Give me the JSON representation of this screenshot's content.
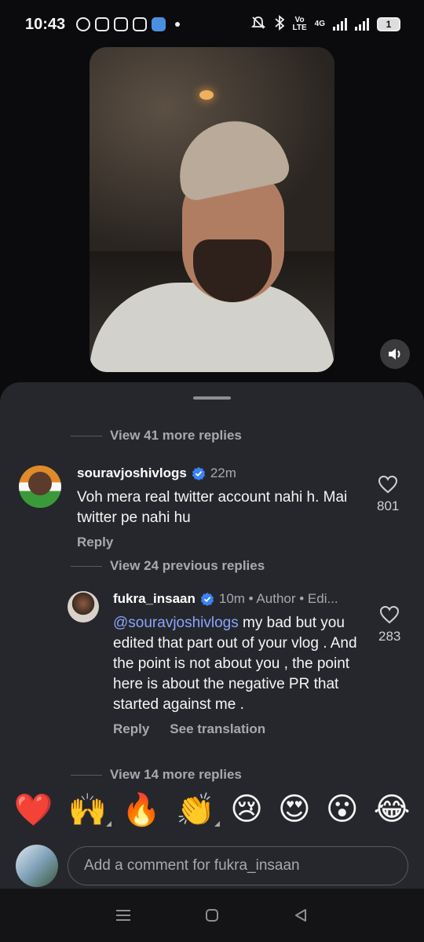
{
  "status_bar": {
    "time": "10:43",
    "net_top": "Vo",
    "net_bottom": "LTE",
    "net_type": "4G",
    "battery": "1"
  },
  "video": {
    "sound_icon": "speaker-icon"
  },
  "thread": {
    "view_more_1": "View 41 more replies",
    "comment_1": {
      "username": "souravjoshivlogs",
      "time": "22m",
      "text": "Voh mera real twitter account nahi h. Mai twitter pe nahi hu",
      "reply_label": "Reply",
      "likes": "801"
    },
    "view_previous": "View 24 previous replies",
    "comment_2": {
      "username": "fukra_insaan",
      "meta": "10m • Author • Edi...",
      "mention": "@souravjoshivlogs",
      "text": " my bad but you edited that part out of your vlog . And the point is not about you , the point here is about the negative PR that started against me .",
      "reply_label": "Reply",
      "translate_label": "See translation",
      "likes": "283"
    },
    "view_more_2": "View 14 more replies"
  },
  "emojis": [
    "❤️",
    "🙌",
    "🔥",
    "👏",
    "😢",
    "😍",
    "😮",
    "😂"
  ],
  "comment_input": {
    "placeholder": "Add a comment for fukra_insaan"
  },
  "colors": {
    "sheet_bg": "#26272c",
    "verified_blue": "#3b82f6",
    "mention_blue": "#8aa4ff"
  }
}
